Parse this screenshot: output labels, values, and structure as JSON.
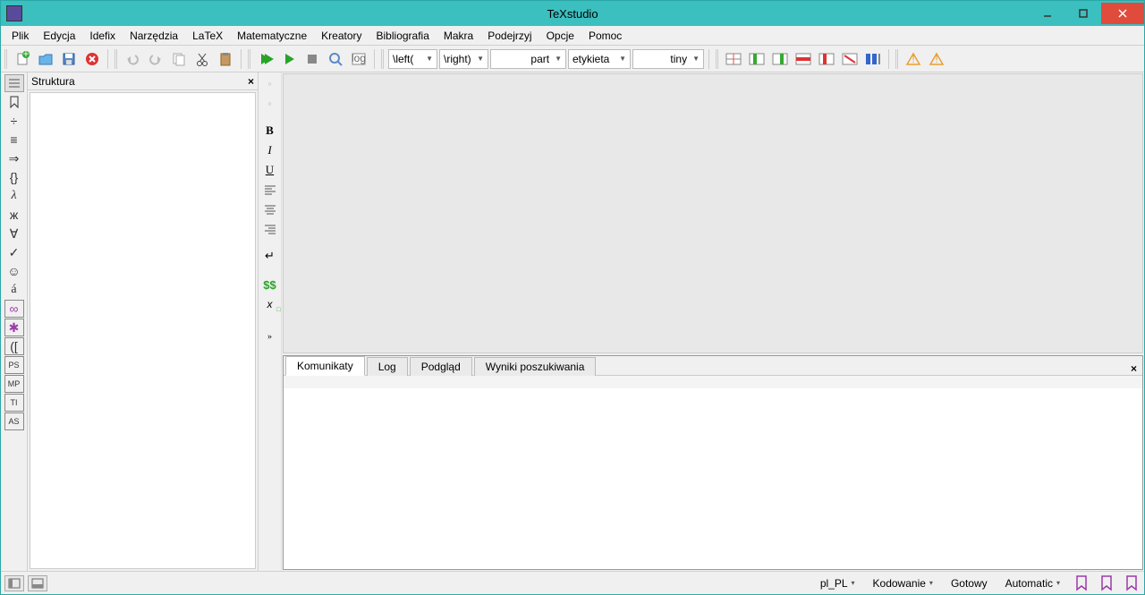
{
  "title": "TeXstudio",
  "menu": [
    "Plik",
    "Edycja",
    "Idefix",
    "Narzędzia",
    "LaTeX",
    "Matematyczne",
    "Kreatory",
    "Bibliografia",
    "Makra",
    "Podejrzyj",
    "Opcje",
    "Pomoc"
  ],
  "toolbar": {
    "dd_left": "\\left(",
    "dd_right": "\\right)",
    "dd_part": "part",
    "dd_label": "etykieta",
    "dd_size": "tiny"
  },
  "structure_panel": {
    "title": "Struktura"
  },
  "editor_icons": {
    "bold": "B",
    "italic": "I",
    "underline": "U",
    "dollars": "$$",
    "xsub": "x"
  },
  "messages": {
    "tabs": [
      "Komunikaty",
      "Log",
      "Podgląd",
      "Wyniki poszukiwania"
    ],
    "active": 0
  },
  "status": {
    "locale": "pl_PL",
    "encoding": "Kodowanie",
    "ready": "Gotowy",
    "automatic": "Automatic"
  },
  "left_sidebar_icons": [
    "list",
    "bookmark",
    "divide",
    "equiv",
    "arrow",
    "braces",
    "lambda",
    "zhe",
    "forall",
    "check",
    "smiley",
    "a-acute",
    "infinity",
    "asterisk",
    "brackets",
    "ps",
    "mp",
    "ti",
    "as"
  ]
}
